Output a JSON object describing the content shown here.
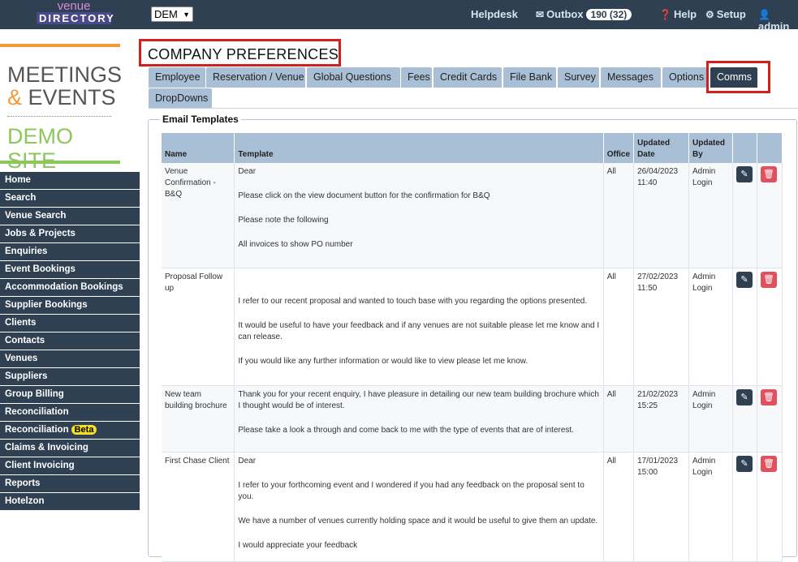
{
  "brand": {
    "logo_line1": "venue",
    "logo_line2": "DIRECTORY"
  },
  "header": {
    "office": "DEM",
    "helpdesk": "Helpdesk",
    "outbox": "Outbox",
    "outbox_count": "190 (32)",
    "help": "Help",
    "setup": "Setup",
    "admin": "admin"
  },
  "site": {
    "line1": "MEETINGS",
    "amp": "&",
    "line2": "EVENTS",
    "line3": "DEMO SITE"
  },
  "menu": [
    {
      "label": "Home"
    },
    {
      "label": "Search"
    },
    {
      "label": "Venue Search"
    },
    {
      "label": "Jobs & Projects"
    },
    {
      "label": "Enquiries"
    },
    {
      "label": "Event Bookings"
    },
    {
      "label": "Accommodation Bookings"
    },
    {
      "label": "Supplier Bookings"
    },
    {
      "label": "Clients"
    },
    {
      "label": "Contacts"
    },
    {
      "label": "Venues"
    },
    {
      "label": "Suppliers"
    },
    {
      "label": "Group Billing"
    },
    {
      "label": "Reconciliation"
    },
    {
      "label": "Reconciliation",
      "badge": "Beta"
    },
    {
      "label": "Claims & Invoicing"
    },
    {
      "label": "Client Invoicing"
    },
    {
      "label": "Reports"
    },
    {
      "label": "Hotelzon"
    }
  ],
  "page_title": "COMPANY PREFERENCES",
  "tabs": [
    {
      "label": "Employee"
    },
    {
      "label": "Reservation / Venue"
    },
    {
      "label": "Global Questions"
    },
    {
      "label": "Fees"
    },
    {
      "label": "Credit Cards"
    },
    {
      "label": "File Bank"
    },
    {
      "label": "Survey"
    },
    {
      "label": "Messages"
    },
    {
      "label": "Options"
    },
    {
      "label": "Comms",
      "active": true
    },
    {
      "label": "DropDowns"
    }
  ],
  "section_title": "Email Templates",
  "table": {
    "headers": {
      "name": "Name",
      "template": "Template",
      "office": "Office",
      "updated_date": "Updated Date",
      "updated_by": "Updated By"
    },
    "rows": [
      {
        "name": "Venue Confirmation - B&Q",
        "template": [
          "Dear",
          "Please click on the view document button for the confirmation for B&Q",
          "Please note the following",
          "All invoices to show PO number"
        ],
        "office": "All",
        "updated_date": "26/04/2023 11:40",
        "updated_by": "Admin Login"
      },
      {
        "name": "Proposal Follow up",
        "template": [
          "",
          "I refer to our recent proposal and wanted to touch base with you regarding the options presented.",
          "It would be useful to have your feedback and if any venues are not suitable please let me know and I can release.",
          "If you would like any further information or would like to view please let me know."
        ],
        "office": "All",
        "updated_date": "27/02/2023 11:50",
        "updated_by": "Admin Login"
      },
      {
        "name": "New team building brochure",
        "template": [
          "Thank you for your recent enquiry, I have pleasure in detailing our new team building brochure which I thought would be of interest.",
          "Please take a look a through and come back to me with the type of events that are of interest."
        ],
        "office": "All",
        "updated_date": "21/02/2023 15:25",
        "updated_by": "Admin Login"
      },
      {
        "name": "First Chase Client",
        "template": [
          "Dear",
          "I refer to your forthcoming event and I wondered if you had any feedback on the proposal sent to you.",
          "We have a number of venues currently holding space and it would be useful to give them an update.",
          "I would appreciate your feedback"
        ],
        "office": "All",
        "updated_date": "17/01/2023 15:00",
        "updated_by": "Admin Login"
      }
    ]
  },
  "colors": {
    "navy": "#2f4052",
    "tab": "#a9bfd6",
    "highlight": "#d21f1f",
    "beta": "#f5e11d",
    "delete": "#e0505e"
  }
}
